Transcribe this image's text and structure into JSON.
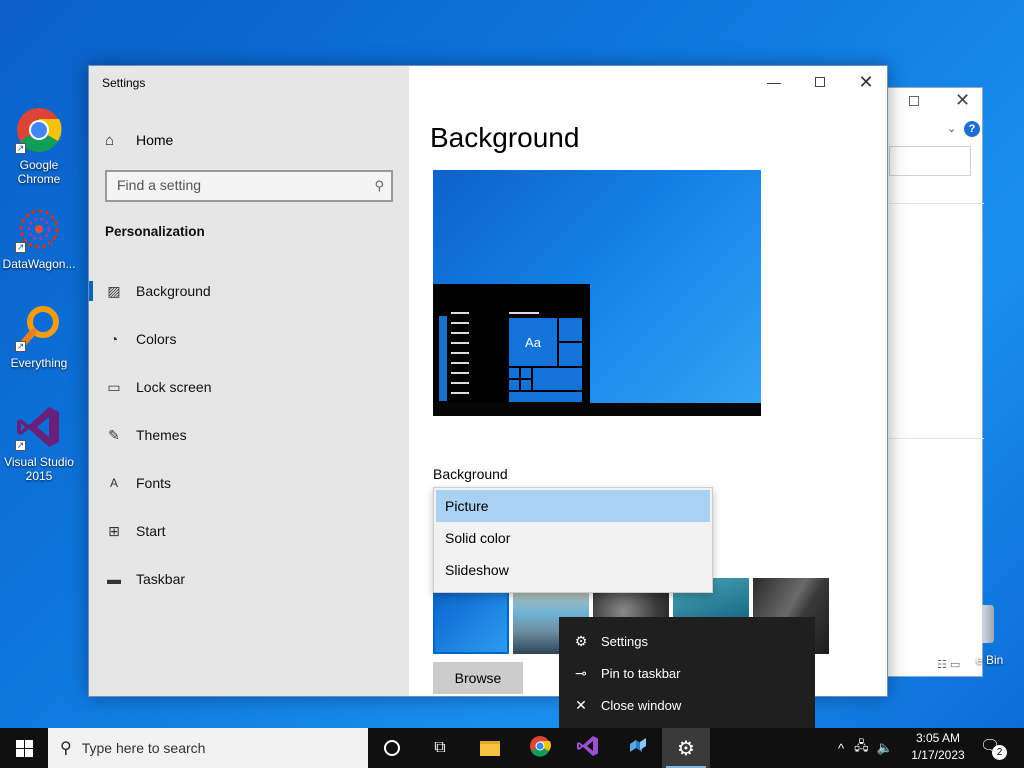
{
  "desktop": {
    "icons": [
      {
        "label": "Google Chrome",
        "icon": "chrome-icon"
      },
      {
        "label": "DataWagon...",
        "icon": "datawagon-icon"
      },
      {
        "label": "Everything",
        "icon": "everything-icon"
      },
      {
        "label": "Visual Studio 2015",
        "icon": "visual-studio-icon"
      }
    ],
    "recycle_bin_label": "e Bin"
  },
  "background_window": {
    "help_label": "?"
  },
  "settings": {
    "window_title": "Settings",
    "home_label": "Home",
    "search_placeholder": "Find a setting",
    "section_title": "Personalization",
    "nav_items": [
      {
        "label": "Background",
        "icon": "picture-icon",
        "active": true
      },
      {
        "label": "Colors",
        "icon": "palette-icon",
        "active": false
      },
      {
        "label": "Lock screen",
        "icon": "lock-screen-icon",
        "active": false
      },
      {
        "label": "Themes",
        "icon": "themes-icon",
        "active": false
      },
      {
        "label": "Fonts",
        "icon": "fonts-icon",
        "active": false
      },
      {
        "label": "Start",
        "icon": "start-icon",
        "active": false
      },
      {
        "label": "Taskbar",
        "icon": "taskbar-icon",
        "active": false
      }
    ],
    "page_title": "Background",
    "preview_tile_text": "Aa",
    "background_label": "Background",
    "background_options": [
      "Picture",
      "Solid color",
      "Slideshow"
    ],
    "background_selected": "Picture",
    "browse_label": "Browse"
  },
  "jump_list": {
    "items": [
      {
        "label": "Settings",
        "icon": "gear-icon"
      },
      {
        "label": "Pin to taskbar",
        "icon": "pin-icon"
      },
      {
        "label": "Close window",
        "icon": "close-icon"
      }
    ]
  },
  "taskbar": {
    "search_placeholder": "Type here to search",
    "apps": [
      "cortana-icon",
      "task-view-icon",
      "file-explorer-icon",
      "chrome-icon",
      "visual-studio-icon",
      "datawagon-icon",
      "settings-gear-icon"
    ],
    "time": "3:05 AM",
    "date": "1/17/2023",
    "notification_count": "2"
  },
  "colors": {
    "accent": "#0067c0",
    "taskbar": "#101010",
    "nav_bg": "#e6e6e6"
  }
}
